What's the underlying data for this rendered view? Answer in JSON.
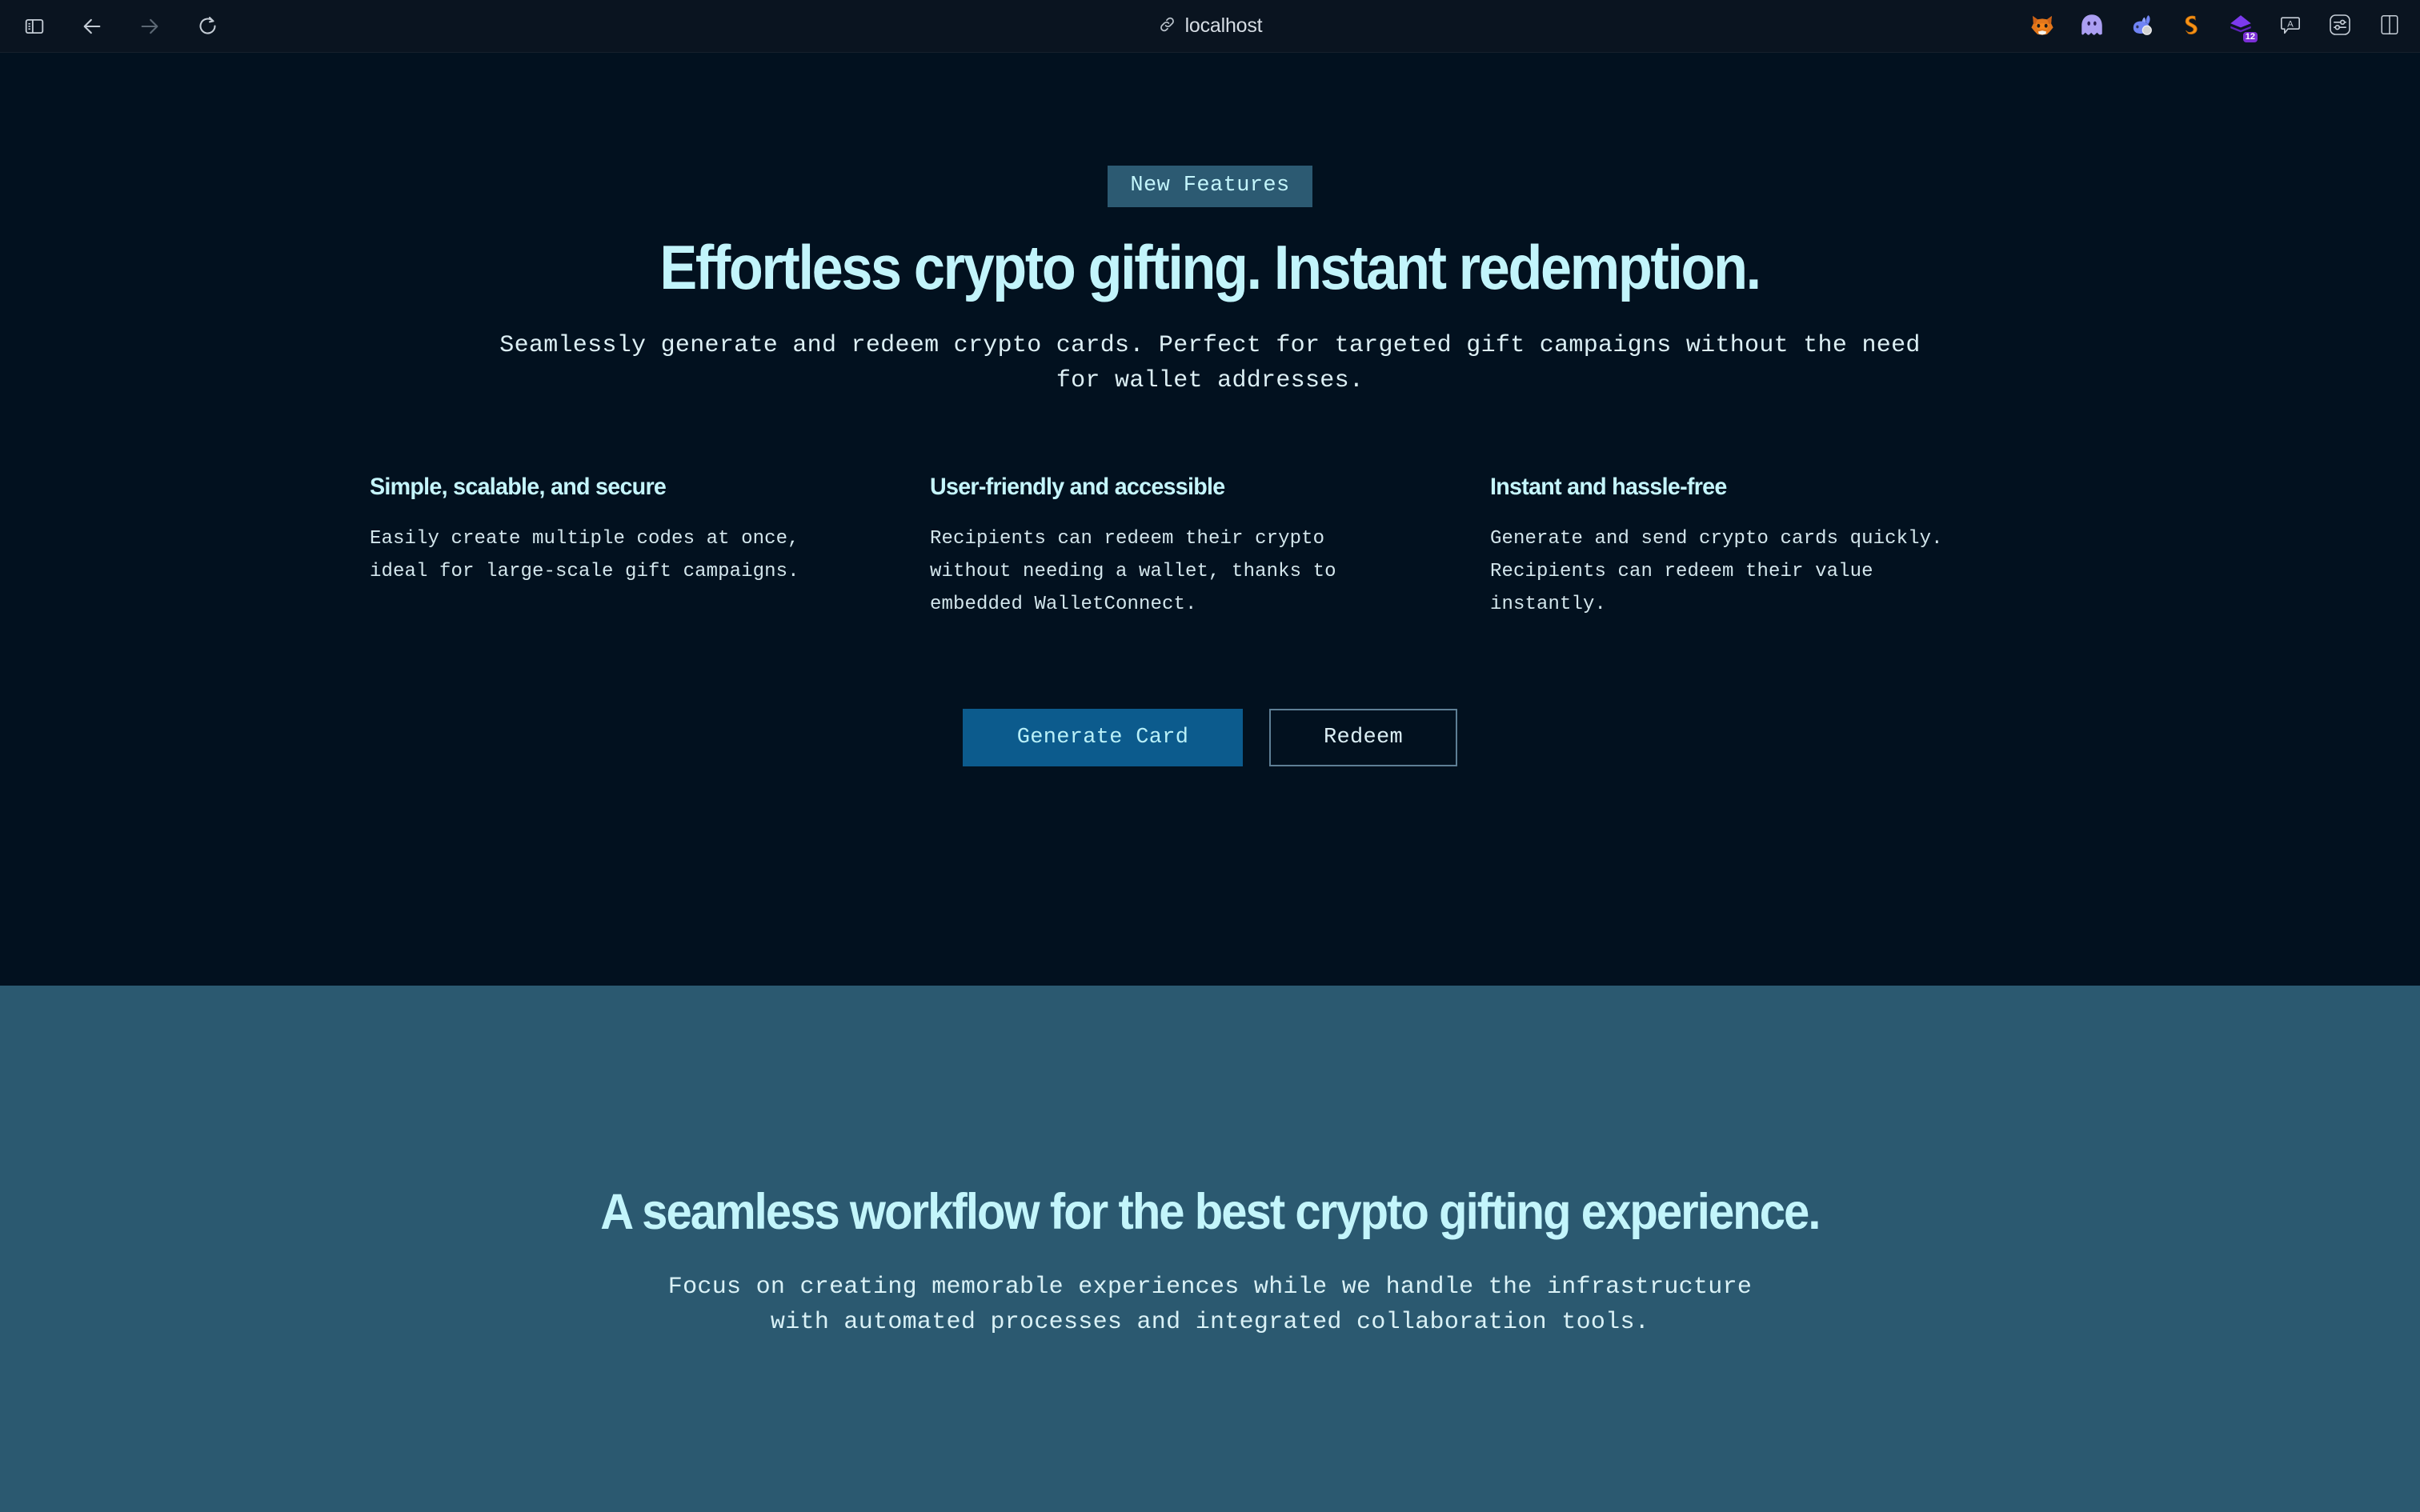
{
  "browser": {
    "nav": {
      "sidebar_toggle": "sidebar-toggle",
      "back": "back",
      "forward": "forward",
      "reload": "reload"
    },
    "address": {
      "url": "localhost",
      "icon": "link-icon"
    },
    "extensions": [
      {
        "name": "metamask-extension",
        "icon": "fox-icon",
        "badge": ""
      },
      {
        "name": "phantom-wallet-extension",
        "icon": "ghost-icon",
        "badge": ""
      },
      {
        "name": "rabby-wallet-extension",
        "icon": "rabbit-icon",
        "badge": ""
      },
      {
        "name": "snap-extension",
        "icon": "s-logo-icon",
        "badge": ""
      },
      {
        "name": "diamond-extension",
        "icon": "diamond-icon",
        "badge": "12"
      },
      {
        "name": "translate-extension",
        "icon": "speech-bubble-a-icon",
        "badge": ""
      },
      {
        "name": "settings-extension",
        "icon": "sliders-icon",
        "badge": ""
      },
      {
        "name": "split-view-toggle",
        "icon": "split-panel-icon",
        "badge": ""
      }
    ]
  },
  "hero": {
    "badge_label": "New Features",
    "title": "Effortless crypto gifting. Instant redemption.",
    "subtitle": "Seamlessly generate and redeem crypto cards. Perfect for targeted gift campaigns without the need for wallet addresses.",
    "features": [
      {
        "title": "Simple, scalable, and secure",
        "body": "Easily create multiple codes at once, ideal for large-scale gift campaigns."
      },
      {
        "title": "User-friendly and accessible",
        "body": "Recipients can redeem their crypto without needing a wallet, thanks to embedded WalletConnect."
      },
      {
        "title": "Instant and hassle-free",
        "body": "Generate and send crypto cards quickly. Recipients can redeem their value instantly."
      }
    ],
    "primary_cta": "Generate Card",
    "secondary_cta": "Redeem"
  },
  "workflow": {
    "title": "A seamless workflow for the best crypto gifting experience.",
    "subtitle": "Focus on creating memorable experiences while we handle the infrastructure with automated processes and integrated collaboration tools."
  },
  "colors": {
    "hero_bg": "#02111f",
    "workflow_bg": "#2b5970",
    "chrome_bg": "#0a1420",
    "accent_text": "#c3f5fb",
    "primary_button": "#0c5b8d",
    "badge_bg": "#2c5a72"
  }
}
